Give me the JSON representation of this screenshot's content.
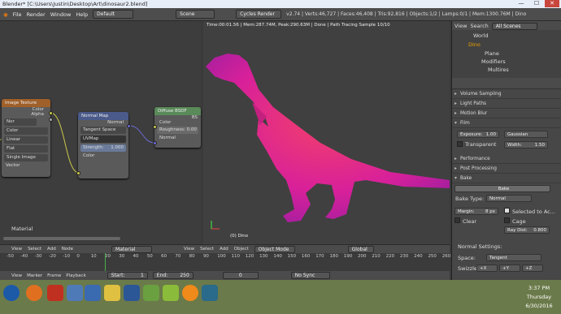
{
  "window": {
    "title": "Blender* [C:\\Users\\Justin\\Desktop\\Art\\dinosaur2.blend]"
  },
  "menu": {
    "items": [
      "File",
      "Render",
      "Window",
      "Help"
    ],
    "layout": "Default",
    "scene": "Scene",
    "engine": "Cycles Render",
    "stats": "v2.74 | Verts:46,727 | Faces:46,408 | Tris:92,816 | Objects:1/2 | Lamps:0/1 | Mem:1300.76M | Dino"
  },
  "nodes": {
    "image_texture": {
      "title": "Image Texture",
      "color": "Color",
      "alpha": "Alpha",
      "color_space": "Color",
      "interp": "Linear",
      "proj": "Flat",
      "ext": "Single Image",
      "vector": "Vector",
      "img": "Nor"
    },
    "normal_map": {
      "title": "Normal Map",
      "normal": "Normal",
      "space": "Tangent Space",
      "uv": "UVMap",
      "strength": "Strength:",
      "strength_val": "1.000",
      "color": "Color"
    },
    "diffuse": {
      "title": "Diffuse BSDF",
      "bsdf": "BS",
      "color": "Color",
      "roughness": "Roughness: 0.00",
      "normal": "Normal"
    },
    "material_label": "Material"
  },
  "viewport": {
    "info": "Time:00:01.56 | Mem:287.74M, Peak:290.63M | Done | Path Tracing Sample 10/10",
    "object_label": "(0) Dino"
  },
  "header1": {
    "items": [
      "View",
      "Select",
      "Add",
      "Node"
    ],
    "material": "Material",
    "view3d": [
      "View",
      "Select",
      "Add",
      "Object"
    ],
    "mode": "Object Mode",
    "orient": "Global"
  },
  "timeline": {
    "ticks": [
      "-50",
      "-40",
      "-30",
      "-20",
      "-10",
      "0",
      "10",
      "20",
      "30",
      "40",
      "50",
      "60",
      "70",
      "80",
      "90",
      "100",
      "110",
      "120",
      "130",
      "140",
      "150",
      "160",
      "170",
      "180",
      "190",
      "200",
      "210",
      "220",
      "230",
      "240",
      "250",
      "260"
    ]
  },
  "header2": {
    "items": [
      "View",
      "Marker",
      "Frame",
      "Playback"
    ],
    "start": "Start:",
    "start_val": "1",
    "end": "End:",
    "end_val": "250",
    "frame": "0",
    "sync": "No Sync"
  },
  "outliner": {
    "tabs": [
      "View",
      "Search",
      "All Scenes"
    ],
    "items": [
      "World",
      "Dino",
      "Plane",
      "Modifiers",
      "Multires"
    ]
  },
  "props": {
    "panels": [
      "Volume Sampling",
      "Light Paths",
      "Motion Blur",
      "Film",
      "Performance",
      "Post Processing",
      "Bake"
    ],
    "exposure": "Exposure:",
    "exposure_val": "1.00",
    "filter": "Gaussian",
    "transparent": "Transparent",
    "width": "Width:",
    "width_val": "1.50",
    "bake_button": "Bake",
    "bake_type_label": "Bake Type:",
    "bake_type": "Normal",
    "margin": "Margin:",
    "margin_val": "8 px",
    "selected": "Selected to Ac...",
    "clear": "Clear",
    "cage": "Cage",
    "ray_dist": "Ray Dist:",
    "ray_dist_val": "0.800",
    "normal_settings": "Normal Settings:",
    "space_label": "Space:",
    "space": "Tangent",
    "swizzle_label": "Swizzle:",
    "sw": [
      "+X",
      "+Y",
      "+Z"
    ]
  },
  "taskbar": {
    "time": "3:37 PM",
    "day": "Thursday",
    "date": "6/30/2016"
  }
}
